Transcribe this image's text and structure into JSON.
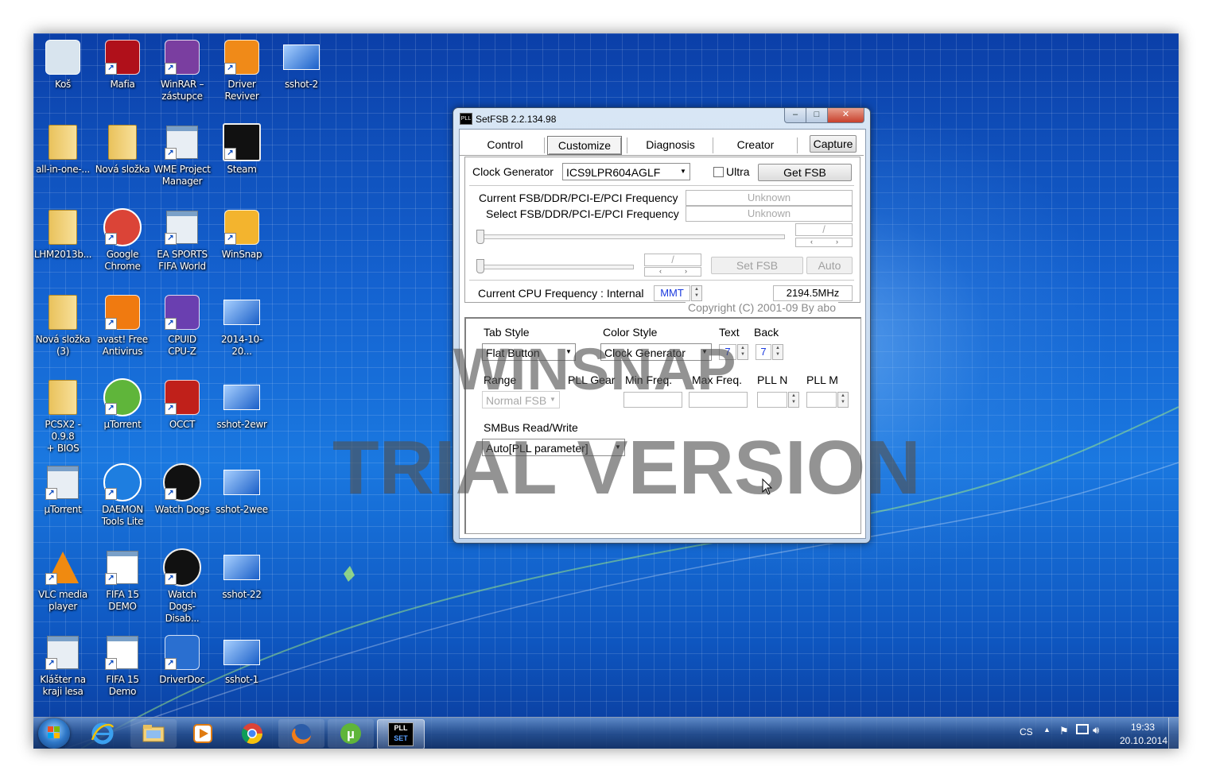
{
  "desktop": {
    "icons": [
      {
        "label": "Koš",
        "icon": "recycle-bin-icon"
      },
      {
        "label": "Mafia",
        "icon": "mafia-icon"
      },
      {
        "label": "WinRAR –\nzástupce",
        "icon": "winrar-icon"
      },
      {
        "label": "Driver\nReviver",
        "icon": "driver-reviver-icon"
      },
      {
        "label": "sshot-2",
        "icon": "image-file-icon"
      },
      {
        "label": "all-in-one-...",
        "icon": "folder-icon"
      },
      {
        "label": "Nová složka",
        "icon": "folder-icon"
      },
      {
        "label": "WME Project\nManager",
        "icon": "app-window-icon"
      },
      {
        "label": "Steam",
        "icon": "steam-icon"
      },
      {
        "label": "LHM2013b...",
        "icon": "folder-icon"
      },
      {
        "label": "Google\nChrome",
        "icon": "chrome-icon"
      },
      {
        "label": "EA SPORTS\nFIFA World",
        "icon": "app-window-icon"
      },
      {
        "label": "WinSnap",
        "icon": "winsnap-icon"
      },
      {
        "label": "Nová složka\n(3)",
        "icon": "folder-icon"
      },
      {
        "label": "avast! Free\nAntivirus",
        "icon": "avast-icon"
      },
      {
        "label": "CPUID\nCPU-Z",
        "icon": "cpuz-icon"
      },
      {
        "label": "2014-10-20...",
        "icon": "image-file-icon"
      },
      {
        "label": "PCSX2 - 0.9.8\n+ BIOS",
        "icon": "folder-icon"
      },
      {
        "label": "µTorrent",
        "icon": "utorrent-icon"
      },
      {
        "label": "OCCT",
        "icon": "occt-icon"
      },
      {
        "label": "sshot-2ewr",
        "icon": "image-file-icon"
      },
      {
        "label": "µTorrent",
        "icon": "app-window-icon"
      },
      {
        "label": "DAEMON\nTools Lite",
        "icon": "daemon-tools-icon"
      },
      {
        "label": "Watch Dogs",
        "icon": "watch-dogs-icon"
      },
      {
        "label": "sshot-2wee",
        "icon": "image-file-icon"
      },
      {
        "label": "VLC media\nplayer",
        "icon": "vlc-icon"
      },
      {
        "label": "FIFA 15\nDEMO",
        "icon": "document-icon"
      },
      {
        "label": "Watch\nDogs-Disab...",
        "icon": "watch-dogs-icon"
      },
      {
        "label": "sshot-22",
        "icon": "image-file-icon"
      },
      {
        "label": "Klášter na\nkraji lesa",
        "icon": "app-window-icon"
      },
      {
        "label": "FIFA 15\nDemo",
        "icon": "document-icon"
      },
      {
        "label": "DriverDoc",
        "icon": "driverdoc-icon"
      },
      {
        "label": "sshot-1",
        "icon": "image-file-icon"
      }
    ]
  },
  "window": {
    "title": "SetFSB 2.2.134.98",
    "app_icon_text": "PLL",
    "controls": {
      "minimize": "–",
      "maximize": "□",
      "close": "✕"
    },
    "tabs": [
      {
        "label": "Control",
        "active": false
      },
      {
        "label": "Customize",
        "active": true
      },
      {
        "label": "Diagnosis",
        "active": false
      },
      {
        "label": "Creator",
        "active": false
      }
    ],
    "capture_label": "Capture",
    "clock_generator": {
      "label": "Clock Generator",
      "value": "ICS9LPR604AGLF",
      "ultra_label": "Ultra",
      "ultra_checked": false,
      "get_fsb_label": "Get FSB"
    },
    "frequency": {
      "current_label": "Current FSB/DDR/PCI-E/PCI Frequency",
      "current_value": "Unknown",
      "select_label": "Select FSB/DDR/PCI-E/PCI Frequency",
      "select_value": "Unknown",
      "slash1": "/",
      "slash2": "/",
      "spin_left": "‹",
      "spin_right": "›",
      "set_fsb_label": "Set FSB",
      "auto_label": "Auto"
    },
    "cpu": {
      "label": "Current CPU Frequency : Internal",
      "mode": "MMT",
      "value": "2194.5MHz",
      "copyright": "Copyright (C) 2001-09 By abo"
    },
    "customize": {
      "tab_style_label": "Tab Style",
      "tab_style_value": "Flat Button",
      "color_style_label": "Color Style",
      "color_style_value": "Clock Generator",
      "text_label": "Text",
      "text_value": "7",
      "back_label": "Back",
      "back_value": "7",
      "range_label": "Range",
      "range_value": "Normal FSB",
      "pll_gear_label": "PLL Gear",
      "min_freq_label": "Min Freq.",
      "max_freq_label": "Max Freq.",
      "pll_n_label": "PLL N",
      "pll_m_label": "PLL M",
      "smbus_label": "SMBus Read/Write",
      "smbus_value": "Auto[PLL parameter]"
    }
  },
  "watermark": {
    "line1": "WINSNAP",
    "line2": "TRIAL VERSION"
  },
  "taskbar": {
    "start": "start-orb-icon",
    "items": [
      {
        "icon": "ie-icon",
        "active": false
      },
      {
        "icon": "explorer-icon",
        "active": false
      },
      {
        "icon": "media-player-icon",
        "active": false
      },
      {
        "icon": "chrome-icon",
        "active": false
      },
      {
        "icon": "firefox-icon",
        "active": false
      },
      {
        "icon": "utorrent-icon",
        "active": false
      },
      {
        "icon": "setfsb-icon",
        "active": true
      }
    ],
    "setfsb_top": "PLL",
    "setfsb_bottom": "SET",
    "language": "CS",
    "time": "19:33",
    "date": "20.10.2014"
  },
  "colors": {
    "accent_blue": "#0a4bc0",
    "window_frame": "#c3d6ec",
    "close_red": "#c8402c"
  }
}
